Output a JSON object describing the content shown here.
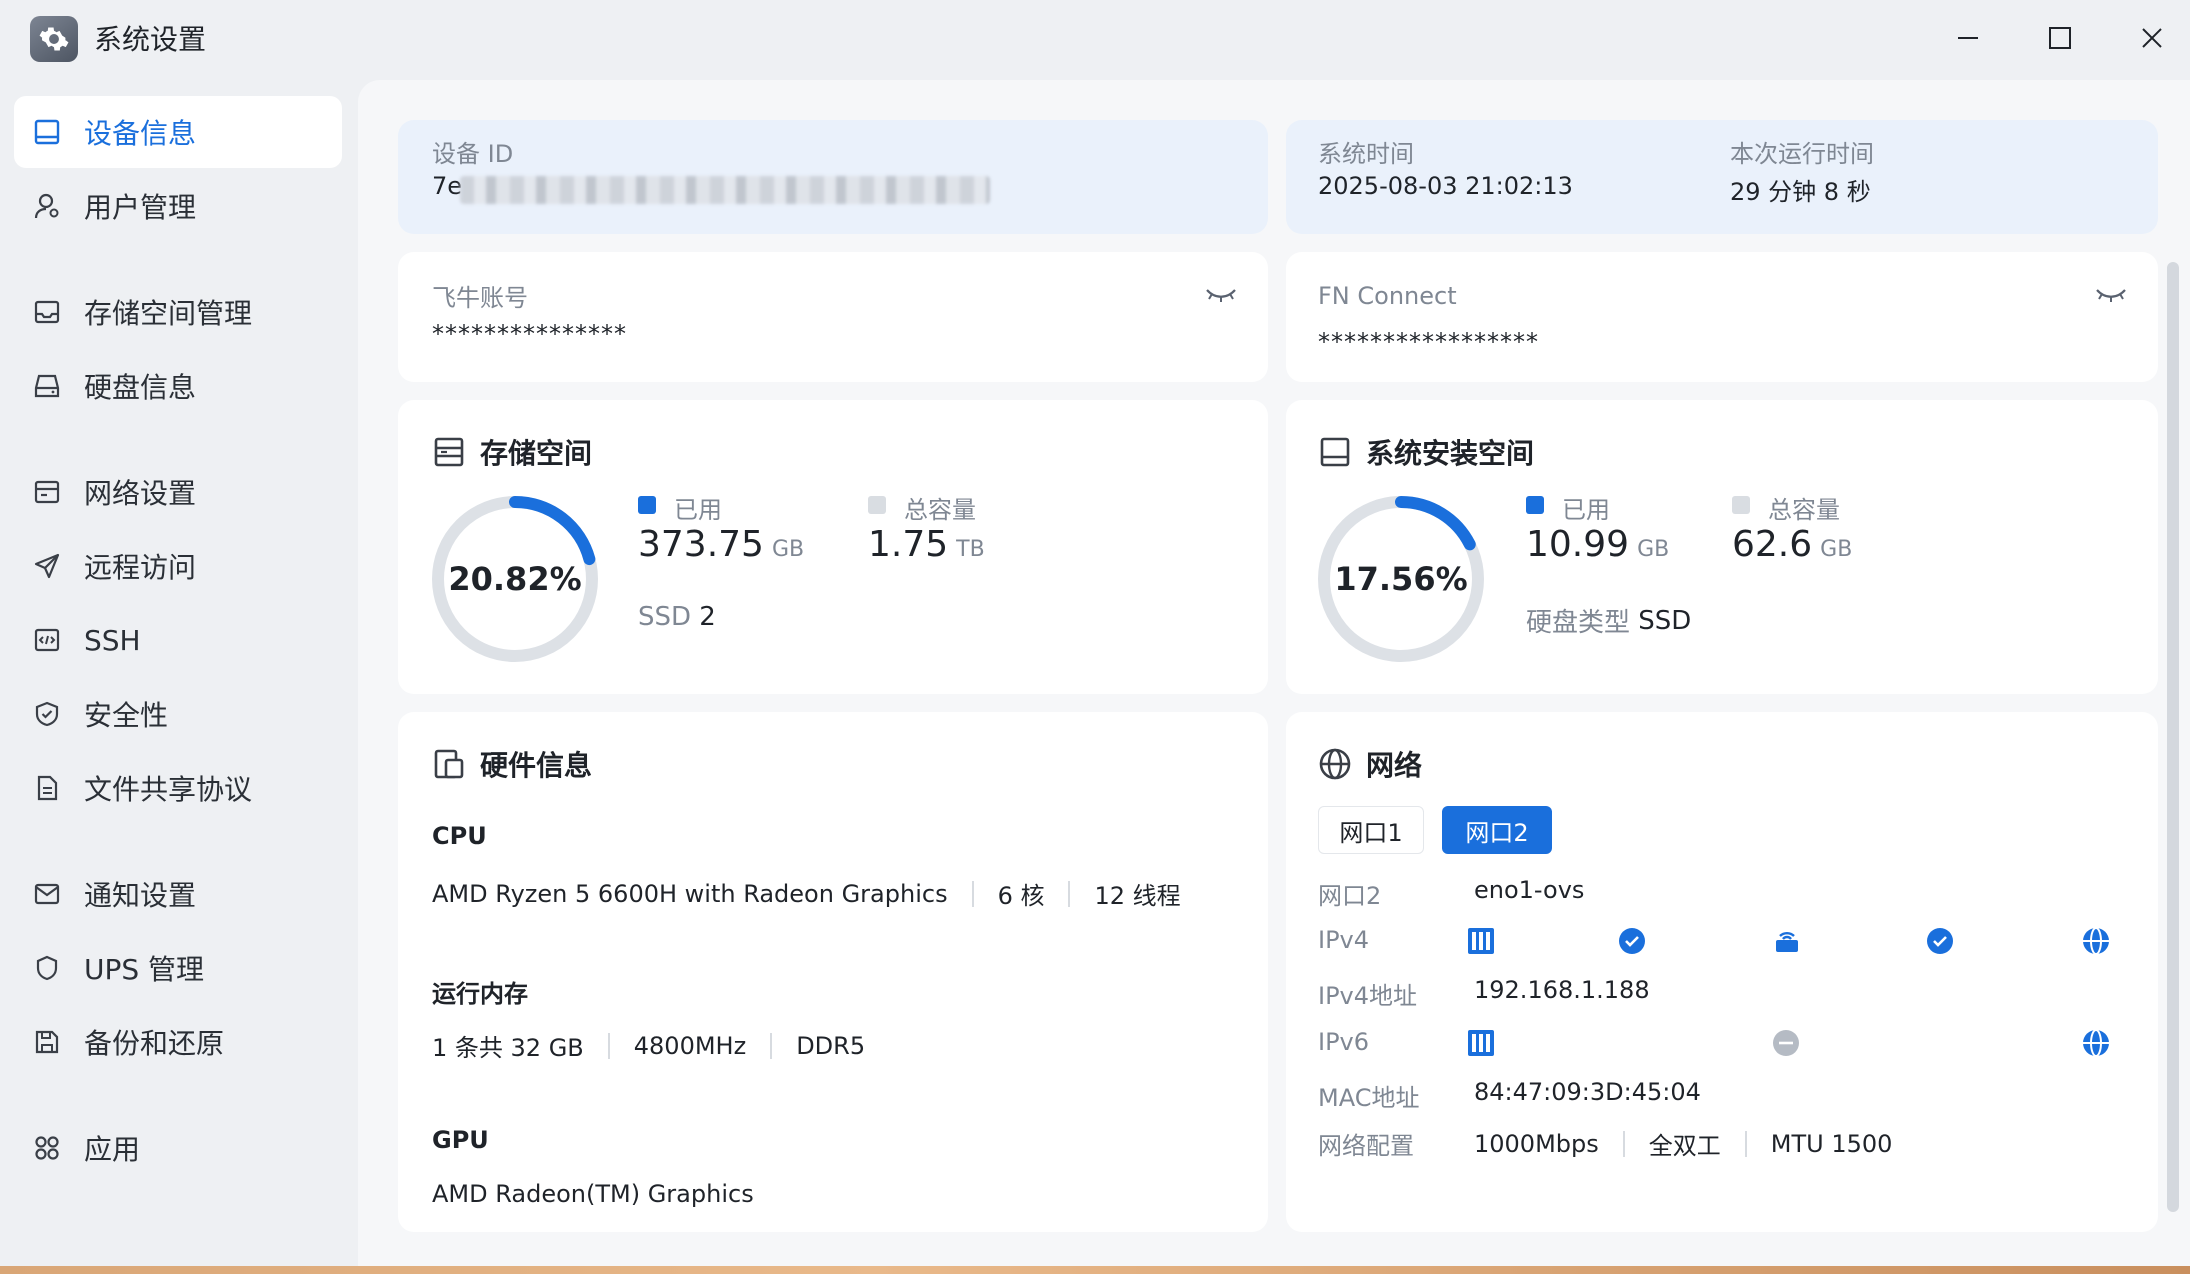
{
  "window": {
    "title": "系统设置",
    "controls": {
      "minimize": "minimize-icon",
      "maximize": "maximize-icon",
      "close": "close-icon"
    }
  },
  "sidebar": {
    "items": [
      {
        "label": "设备信息",
        "icon": "device-info-icon",
        "active": true
      },
      {
        "label": "用户管理",
        "icon": "user-icon"
      },
      {
        "label": "存储空间管理",
        "icon": "storage-icon"
      },
      {
        "label": "硬盘信息",
        "icon": "disk-icon"
      },
      {
        "label": "网络设置",
        "icon": "network-settings-icon"
      },
      {
        "label": "远程访问",
        "icon": "remote-access-icon"
      },
      {
        "label": "SSH",
        "icon": "ssh-icon"
      },
      {
        "label": "安全性",
        "icon": "shield-icon"
      },
      {
        "label": "文件共享协议",
        "icon": "file-share-icon"
      },
      {
        "label": "通知设置",
        "icon": "mail-icon"
      },
      {
        "label": "UPS 管理",
        "icon": "ups-icon"
      },
      {
        "label": "备份和还原",
        "icon": "backup-icon"
      },
      {
        "label": "应用",
        "icon": "apps-icon"
      }
    ]
  },
  "device": {
    "id_label": "设备 ID",
    "id_value": "7e",
    "system_time_label": "系统时间",
    "system_time_value": "2025-08-03 21:02:13",
    "uptime_label": "本次运行时间",
    "uptime_value": "29 分钟 8 秒"
  },
  "accounts": {
    "feiniu_label": "飞牛账号",
    "feiniu_value": "***************",
    "fnconnect_label": "FN Connect",
    "fnconnect_value": "*****************"
  },
  "storage": {
    "title": "存储空间",
    "percent_text": "20.82%",
    "percent": 0.2082,
    "used_label": "已用",
    "used_value": "373.75",
    "used_unit": "GB",
    "total_label": "总容量",
    "total_value": "1.75",
    "total_unit": "TB",
    "ssd_label": "SSD",
    "ssd_count": "2"
  },
  "system_space": {
    "title": "系统安装空间",
    "percent_text": "17.56%",
    "percent": 0.1756,
    "used_label": "已用",
    "used_value": "10.99",
    "used_unit": "GB",
    "total_label": "总容量",
    "total_value": "62.6",
    "total_unit": "GB",
    "disk_type_label": "硬盘类型",
    "disk_type_value": "SSD"
  },
  "hardware": {
    "title": "硬件信息",
    "cpu_label": "CPU",
    "cpu_model": "AMD Ryzen 5 6600H with Radeon Graphics",
    "cpu_cores": "6 核",
    "cpu_threads": "12 线程",
    "ram_label": "运行内存",
    "ram_size": "1 条共 32 GB",
    "ram_freq": "4800MHz",
    "ram_type": "DDR5",
    "gpu_label": "GPU",
    "gpu_model": "AMD Radeon(TM) Graphics"
  },
  "network": {
    "title": "网络",
    "tabs": [
      {
        "label": "网口1",
        "active": false
      },
      {
        "label": "网口2",
        "active": true
      }
    ],
    "port_label": "网口2",
    "port_value": "eno1-ovs",
    "ipv4_label": "IPv4",
    "ipv4_addr_label": "IPv4地址",
    "ipv4_addr_value": "192.168.1.188",
    "ipv6_label": "IPv6",
    "mac_label": "MAC地址",
    "mac_value": "84:47:09:3D:45:04",
    "config_label": "网络配置",
    "config_speed": "1000Mbps",
    "config_duplex": "全双工",
    "config_mtu": "MTU 1500",
    "ipv4_status": "connected",
    "ipv6_status": "disconnected"
  },
  "colors": {
    "accent": "#1a6fdc",
    "used": "#1a6fdc",
    "total": "#d9dde2",
    "track": "#dde1e6"
  }
}
